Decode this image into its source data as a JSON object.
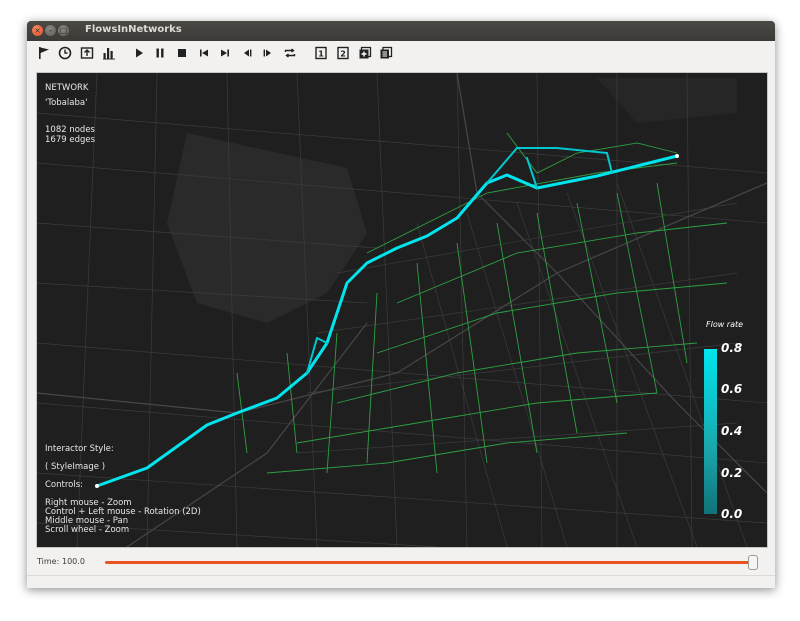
{
  "window": {
    "title": "FlowsInNetworks"
  },
  "toolbar": {
    "buttons": [
      {
        "name": "flag-icon"
      },
      {
        "name": "clock-icon"
      },
      {
        "name": "export-icon"
      },
      {
        "name": "bar-chart-icon"
      },
      {
        "name": "play-icon"
      },
      {
        "name": "pause-icon"
      },
      {
        "name": "stop-icon"
      },
      {
        "name": "skip-start-icon"
      },
      {
        "name": "skip-end-icon"
      },
      {
        "name": "step-back-icon"
      },
      {
        "name": "step-forward-icon"
      },
      {
        "name": "loop-icon"
      },
      {
        "name": "view-1-icon"
      },
      {
        "name": "view-2-icon"
      },
      {
        "name": "add-view-icon"
      },
      {
        "name": "layers-icon"
      }
    ],
    "view1_label": "1",
    "view2_label": "2"
  },
  "overlay": {
    "heading": "NETWORK",
    "network_name": "'Tobalaba'",
    "nodes": "1082 nodes",
    "edges": "1679 edges",
    "interactor_label": "Interactor Style:",
    "interactor_value": "( StyleImage )",
    "controls_label": "Controls:",
    "controls": [
      "Right mouse - Zoom",
      "Control + Left mouse - Rotation (2D)",
      "Middle mouse - Pan",
      "Scroll wheel - Zoom"
    ]
  },
  "legend": {
    "title": "Flow rate",
    "ticks": [
      "0.8",
      "0.6",
      "0.4",
      "0.2",
      "0.0"
    ],
    "color_high": "#00e5ee",
    "color_low": "#0f7378"
  },
  "time": {
    "label": "Time:",
    "value": "100.0",
    "slider_fraction": 1.0,
    "accent": "#e95420"
  }
}
